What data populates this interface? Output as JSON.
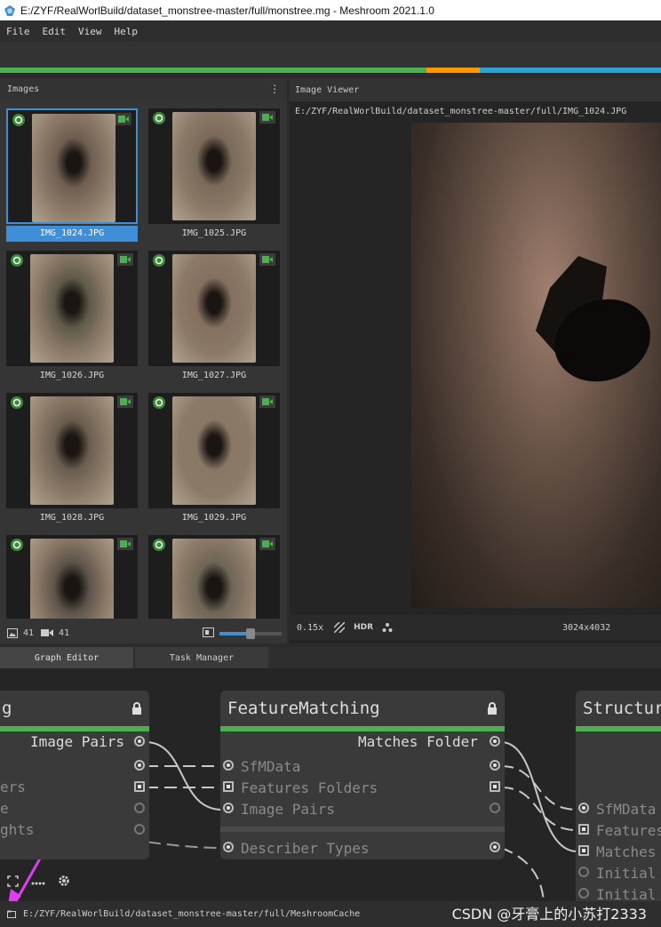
{
  "window": {
    "title": "E:/ZYF/RealWorlBuild/dataset_monstree-master/full/monstree.mg - Meshroom 2021.1.0"
  },
  "menu": [
    "File",
    "Edit",
    "View",
    "Help"
  ],
  "progress_colors": {
    "done": "#4caf50",
    "running": "#ff9800",
    "submitted": "#2aa6d4"
  },
  "progress": {
    "done": 0.645,
    "running": 0.081,
    "submitted": 0.274
  },
  "images_panel": {
    "title": "Images",
    "thumbnails": [
      {
        "label": "IMG_1024.JPG",
        "selected": true
      },
      {
        "label": "IMG_1025.JPG",
        "selected": false
      },
      {
        "label": "IMG_1026.JPG",
        "selected": false
      },
      {
        "label": "IMG_1027.JPG",
        "selected": false
      },
      {
        "label": "IMG_1028.JPG",
        "selected": false
      },
      {
        "label": "IMG_1029.JPG",
        "selected": false
      },
      {
        "label": "",
        "selected": false
      },
      {
        "label": "",
        "selected": false
      }
    ],
    "image_count": "41",
    "camera_count": "41",
    "thumb_size": 0.5
  },
  "viewer": {
    "title": "Image Viewer",
    "path": "E:/ZYF/RealWorlBuild/dataset_monstree-master/full/IMG_1024.JPG",
    "zoom": "0.15x",
    "hdr_label": "HDR",
    "resolution": "3024x4032"
  },
  "tabs": [
    "Graph Editor",
    "Task Manager"
  ],
  "graph": {
    "left_node": {
      "title": "g",
      "attrs": {
        "image_pairs": "Image Pairs",
        "a2": "ers",
        "a3": "e",
        "a4": "ghts"
      }
    },
    "feature_matching": {
      "title": "FeatureMatching",
      "outputs": {
        "matches_folder": "Matches Folder"
      },
      "inputs": {
        "sfm": "SfMData",
        "features": "Features Folders",
        "pairs": "Image Pairs",
        "describer": "Describer Types"
      }
    },
    "structure_node": {
      "title": "Structur",
      "inputs": [
        "SfMData",
        "Features",
        "Matches",
        "Initial",
        "Initial"
      ]
    }
  },
  "status": {
    "cache_path": "E:/ZYF/RealWorlBuild/dataset_monstree-master/full/MeshroomCache"
  },
  "watermark": "CSDN @牙膏上的小苏打2333"
}
